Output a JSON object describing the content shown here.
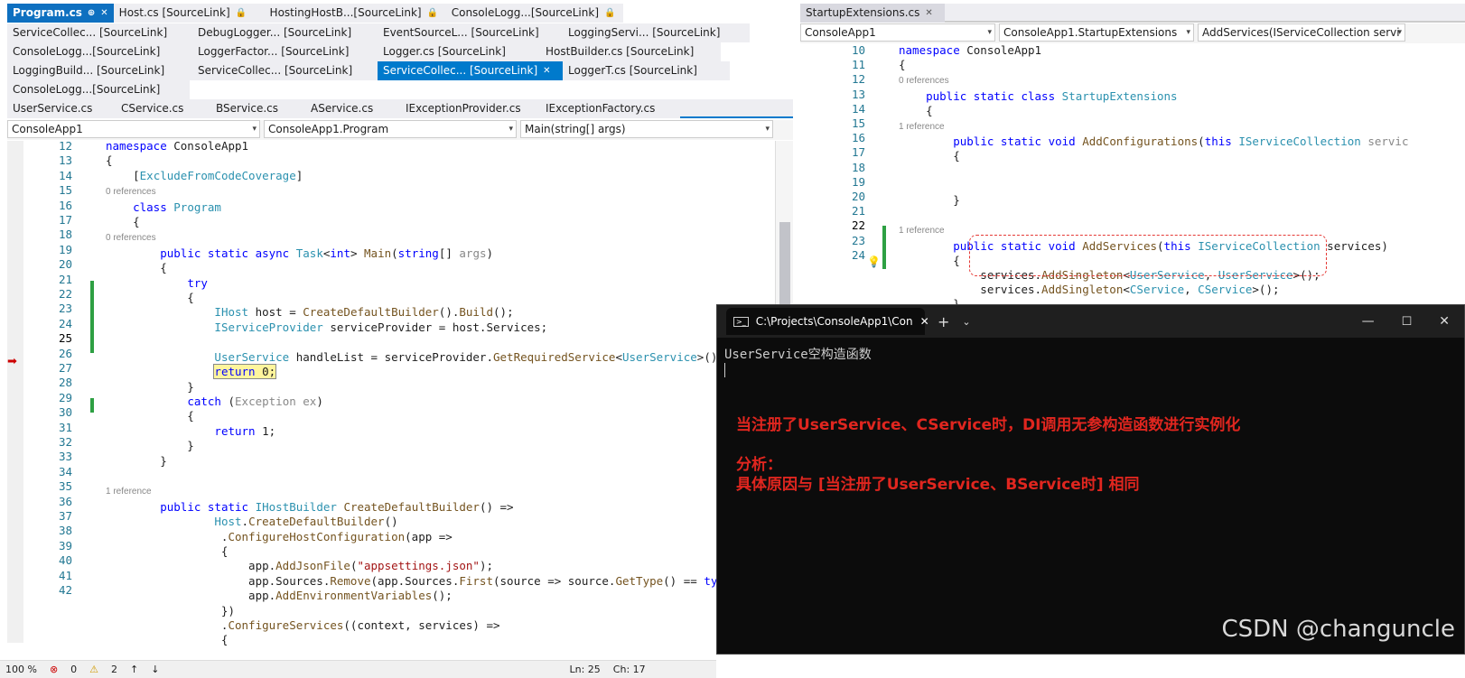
{
  "left_tabs": [
    [
      {
        "label": "Program.cs",
        "active": true
      },
      {
        "label": "Host.cs [SourceLink]"
      },
      {
        "label": "HostingHostB...[SourceLink]"
      },
      {
        "label": "ConsoleLogg...[SourceLink]"
      }
    ],
    [
      {
        "label": "ServiceCollec... [SourceLink]"
      },
      {
        "label": "DebugLogger... [SourceLink]"
      },
      {
        "label": "EventSourceL... [SourceLink]"
      },
      {
        "label": "LoggingServi... [SourceLink]"
      }
    ],
    [
      {
        "label": "ConsoleLogg...[SourceLink]"
      },
      {
        "label": "LoggerFactor... [SourceLink]"
      },
      {
        "label": "Logger.cs [SourceLink]"
      },
      {
        "label": "HostBuilder.cs [SourceLink]"
      }
    ],
    [
      {
        "label": "LoggingBuild... [SourceLink]"
      },
      {
        "label": "ServiceCollec... [SourceLink]"
      },
      {
        "label": "ServiceCollec... [SourceLink]",
        "selected": true
      },
      {
        "label": "LoggerT.cs [SourceLink]"
      }
    ],
    [
      {
        "label": "ConsoleLogg...[SourceLink]"
      }
    ]
  ],
  "left_tabs2": [
    "UserService.cs",
    "CService.cs",
    "BService.cs",
    "AService.cs",
    "IExceptionProvider.cs",
    "IExceptionFactory.cs"
  ],
  "left_nav": {
    "project": "ConsoleApp1",
    "class": "ConsoleApp1.Program",
    "member": "Main(string[] args)"
  },
  "right_tab": "StartupExtensions.cs",
  "right_nav": {
    "project": "ConsoleApp1",
    "class": "ConsoleApp1.StartupExtensions",
    "member": "AddServices(IServiceCollection servi"
  },
  "left_lines": [
    "12",
    "13",
    "14",
    "15",
    "16",
    "17",
    "18",
    "19",
    "20",
    "21",
    "22",
    "23",
    "24",
    "25",
    "26",
    "27",
    "28",
    "29",
    "30",
    "31",
    "32",
    "33",
    "34",
    "35",
    "36",
    "37",
    "38",
    "39",
    "40",
    "41",
    "42"
  ],
  "right_lines": [
    "10",
    "11",
    "12",
    "13",
    "14",
    "15",
    "16",
    "17",
    "18",
    "19",
    "20",
    "21",
    "22",
    "23",
    "24"
  ],
  "refs": {
    "zero": "0 references",
    "one": "1 reference"
  },
  "terminal": {
    "title": "C:\\Projects\\ConsoleApp1\\Con",
    "output": "UserService空构造函数",
    "note1": "当注册了UserService、CService时，DI调用无参构造函数进行实例化",
    "note2": "分析：",
    "note3": "具体原因与 [当注册了UserService、BService时] 相同"
  },
  "watermark": "CSDN @changuncle",
  "status": {
    "zoom": "100 %",
    "errors": "0",
    "warnings": "2",
    "ln": "Ln: 25",
    "ch": "Ch: 17"
  }
}
